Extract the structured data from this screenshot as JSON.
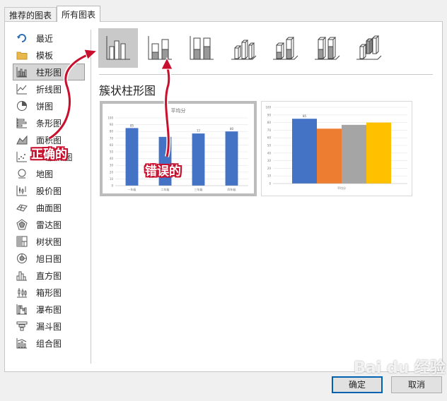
{
  "tabs": [
    {
      "label": "推荐的图表"
    },
    {
      "label": "所有图表"
    }
  ],
  "categories": [
    {
      "label": "最近",
      "icon": "recent-icon"
    },
    {
      "label": "模板",
      "icon": "folder-icon"
    },
    {
      "label": "柱形图",
      "icon": "column-chart-icon"
    },
    {
      "label": "折线图",
      "icon": "line-chart-icon"
    },
    {
      "label": "饼图",
      "icon": "pie-chart-icon"
    },
    {
      "label": "条形图",
      "icon": "bar-chart-icon"
    },
    {
      "label": "面积图",
      "icon": "area-chart-icon"
    },
    {
      "label": "XY散点图",
      "icon": "scatter-chart-icon"
    },
    {
      "label": "地图",
      "icon": "map-chart-icon"
    },
    {
      "label": "股价图",
      "icon": "stock-chart-icon"
    },
    {
      "label": "曲面图",
      "icon": "surface-chart-icon"
    },
    {
      "label": "雷达图",
      "icon": "radar-chart-icon"
    },
    {
      "label": "树状图",
      "icon": "treemap-chart-icon"
    },
    {
      "label": "旭日图",
      "icon": "sunburst-chart-icon"
    },
    {
      "label": "直方图",
      "icon": "histogram-chart-icon"
    },
    {
      "label": "箱形图",
      "icon": "box-whisker-chart-icon"
    },
    {
      "label": "瀑布图",
      "icon": "waterfall-chart-icon"
    },
    {
      "label": "漏斗图",
      "icon": "funnel-chart-icon"
    },
    {
      "label": "组合图",
      "icon": "combo-chart-icon"
    }
  ],
  "selected_category": "柱形图",
  "section_title": "簇状柱形图",
  "annotations": {
    "correct": "正确的",
    "wrong": "错误的"
  },
  "buttons": {
    "ok": "确定",
    "cancel": "取消"
  },
  "watermark": "Bai du 经验",
  "colors": {
    "accent_blue": "#4472c4",
    "orange": "#ed7d31",
    "gray": "#a5a5a5",
    "gold": "#ffc000",
    "annotation_red": "#c8102e"
  },
  "chart_data": [
    {
      "type": "bar",
      "title": "平均分",
      "categories": [
        "一年级",
        "二年级",
        "三年级",
        "四年级"
      ],
      "values": [
        85,
        72,
        77,
        80
      ],
      "ylim": [
        0,
        100
      ],
      "yticks": [
        0,
        10,
        20,
        30,
        40,
        50,
        60,
        70,
        80,
        90,
        100
      ],
      "data_labels": [
        "85",
        "",
        "77",
        "80"
      ]
    },
    {
      "type": "bar",
      "categories": [
        "平均分"
      ],
      "series": [
        {
          "values": [
            85
          ],
          "color": "#4472c4"
        },
        {
          "values": [
            72
          ],
          "color": "#ed7d31"
        },
        {
          "values": [
            77
          ],
          "color": "#a5a5a5"
        },
        {
          "values": [
            80
          ],
          "color": "#ffc000"
        }
      ],
      "ylim": [
        0,
        100
      ],
      "yticks": [
        0,
        10,
        20,
        30,
        40,
        50,
        60,
        70,
        80,
        90,
        100
      ],
      "data_labels": [
        "85"
      ]
    }
  ]
}
